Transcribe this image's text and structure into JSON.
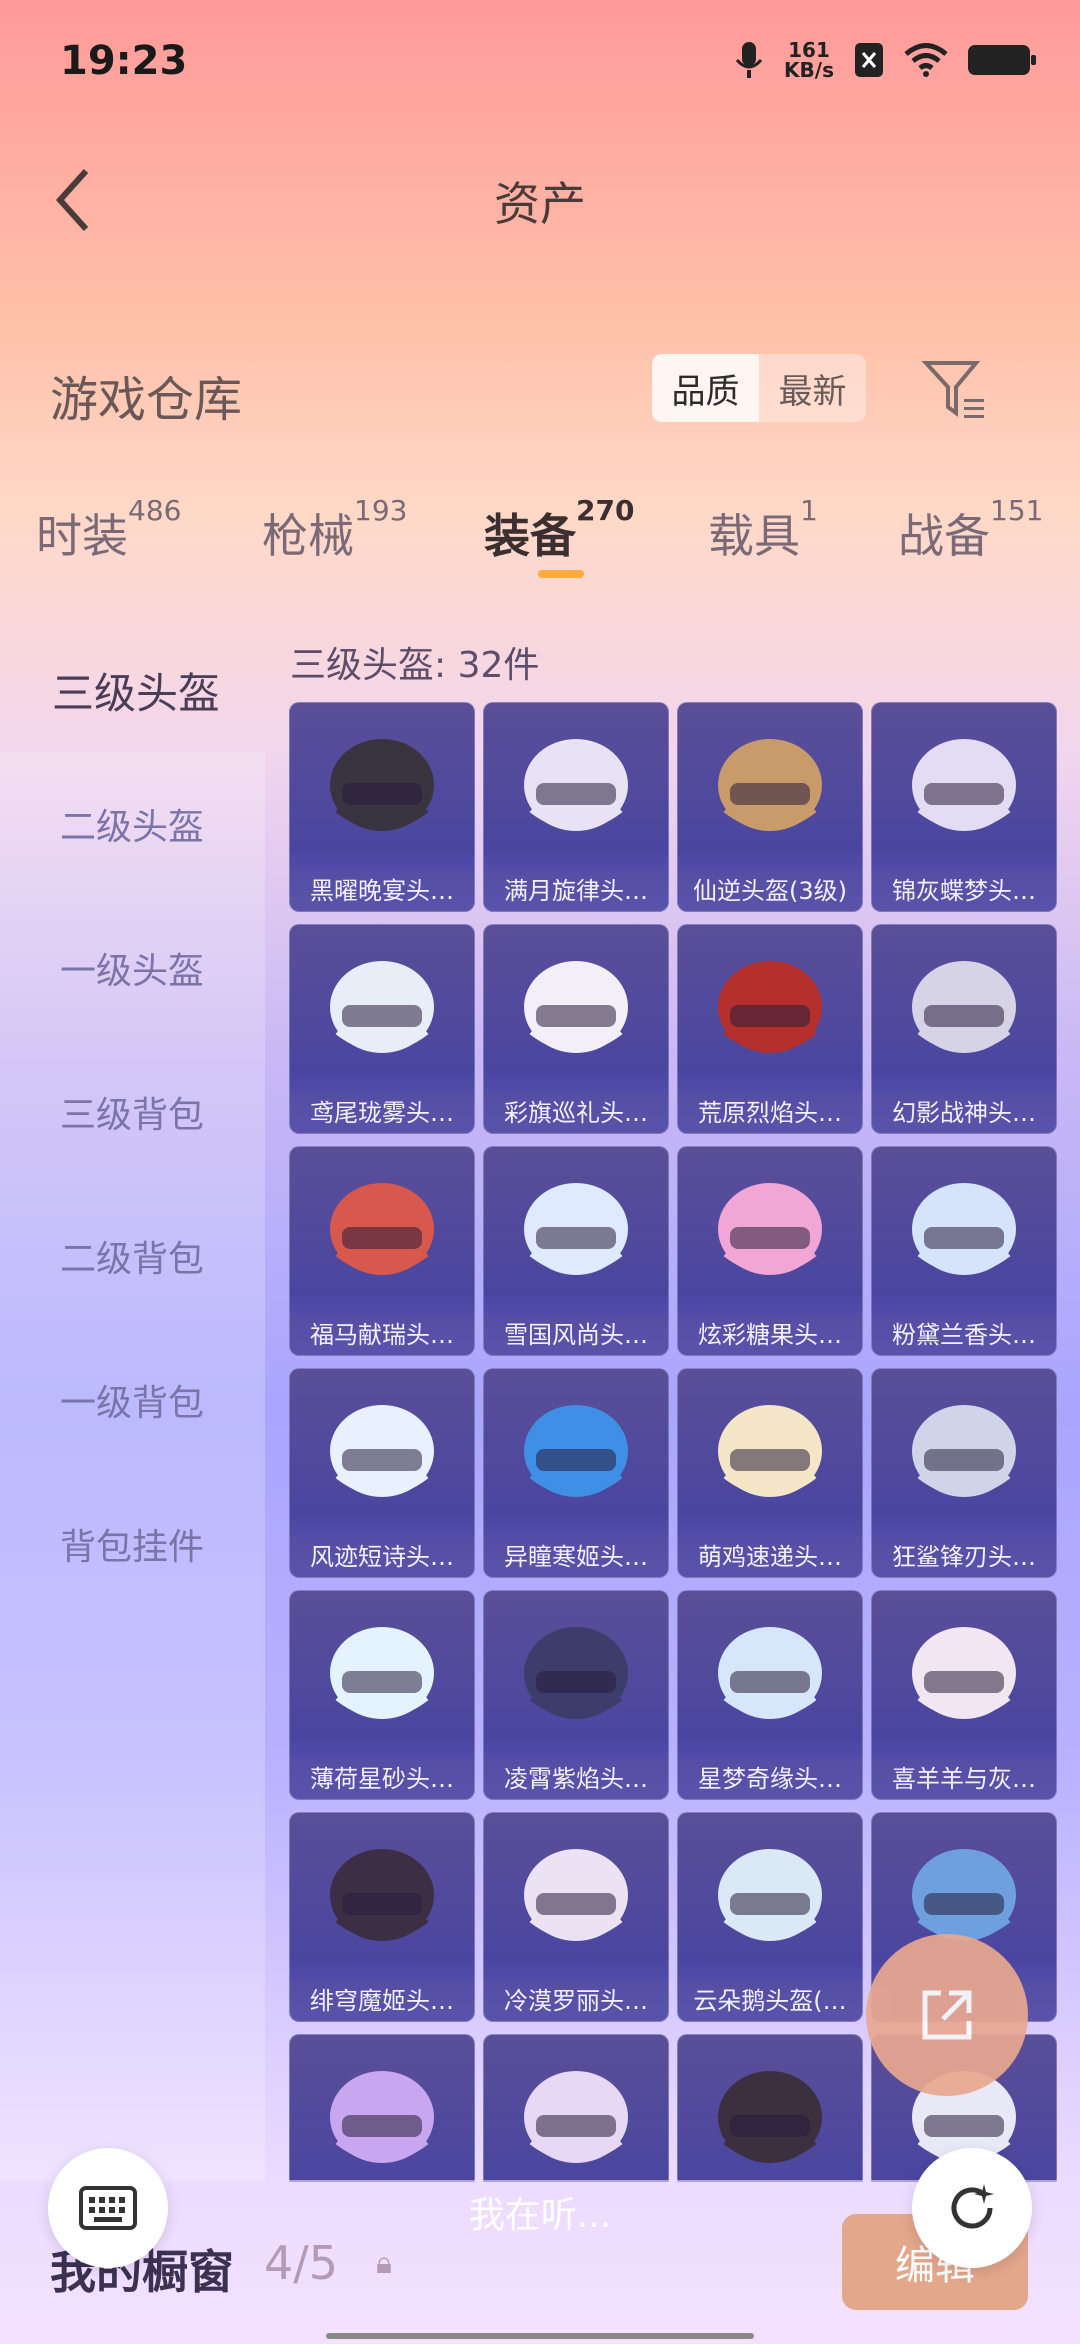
{
  "status": {
    "time": "19:23",
    "net_speed_value": "161",
    "net_speed_unit": "KB/s"
  },
  "header": {
    "title": "资产"
  },
  "warehouse": {
    "title": "游戏仓库",
    "sort_quality": "品质",
    "sort_newest": "最新"
  },
  "tabs": [
    {
      "label": "时装",
      "count": "486"
    },
    {
      "label": "枪械",
      "count": "193"
    },
    {
      "label": "装备",
      "count": "270"
    },
    {
      "label": "载具",
      "count": "1"
    },
    {
      "label": "战备",
      "count": "151"
    }
  ],
  "sidebar": {
    "items": [
      {
        "label": "三级头盔"
      },
      {
        "label": "二级头盔"
      },
      {
        "label": "一级头盔"
      },
      {
        "label": "三级背包"
      },
      {
        "label": "二级背包"
      },
      {
        "label": "一级背包"
      },
      {
        "label": "背包挂件"
      }
    ]
  },
  "content": {
    "count_label": "三级头盔: 32件",
    "items": [
      "黑曜晚宴头…",
      "满月旋律头…",
      "仙逆头盔(3级)",
      "锦灰蝶梦头…",
      "鸢尾珑雾头…",
      "彩旗巡礼头…",
      "荒原烈焰头…",
      "幻影战神头…",
      "福马献瑞头…",
      "雪国风尚头…",
      "炫彩糖果头…",
      "粉黛兰香头…",
      "风迹短诗头…",
      "异瞳寒姬头…",
      "萌鸡速递头…",
      "狂鲨锋刃头…",
      "薄荷星砂头…",
      "凌霄紫焰头…",
      "星梦奇缘头…",
      "喜羊羊与灰…",
      "绯穹魔姬头…",
      "冷漠罗丽头…",
      "云朵鹅头盔(…",
      "",
      "",
      "",
      "",
      ""
    ],
    "helmet_colors": [
      "#3a3340",
      "#e9e2f5",
      "#c99a6a",
      "#e4dcf2",
      "#e9edf7",
      "#f3eef7",
      "#b5302c",
      "#d7d3e6",
      "#d9584d",
      "#dfe9ff",
      "#f2a6d6",
      "#d5e3fb",
      "#e9f1ff",
      "#3f8fe6",
      "#f4e6c6",
      "#cfd4e8",
      "#e5f3ff",
      "#3d3d6b",
      "#d6e6fb",
      "#f1e6f2",
      "#3b2e45",
      "#ebe2f4",
      "#dbe9f7",
      "#6ea0e0",
      "#c8a6f0",
      "#e7d8f6",
      "#3c3040",
      "#e8e8f6"
    ]
  },
  "bottom": {
    "listening": "我在听...",
    "my_showcase": "我的橱窗",
    "showcase_count": "4/5",
    "edit": "编辑"
  }
}
